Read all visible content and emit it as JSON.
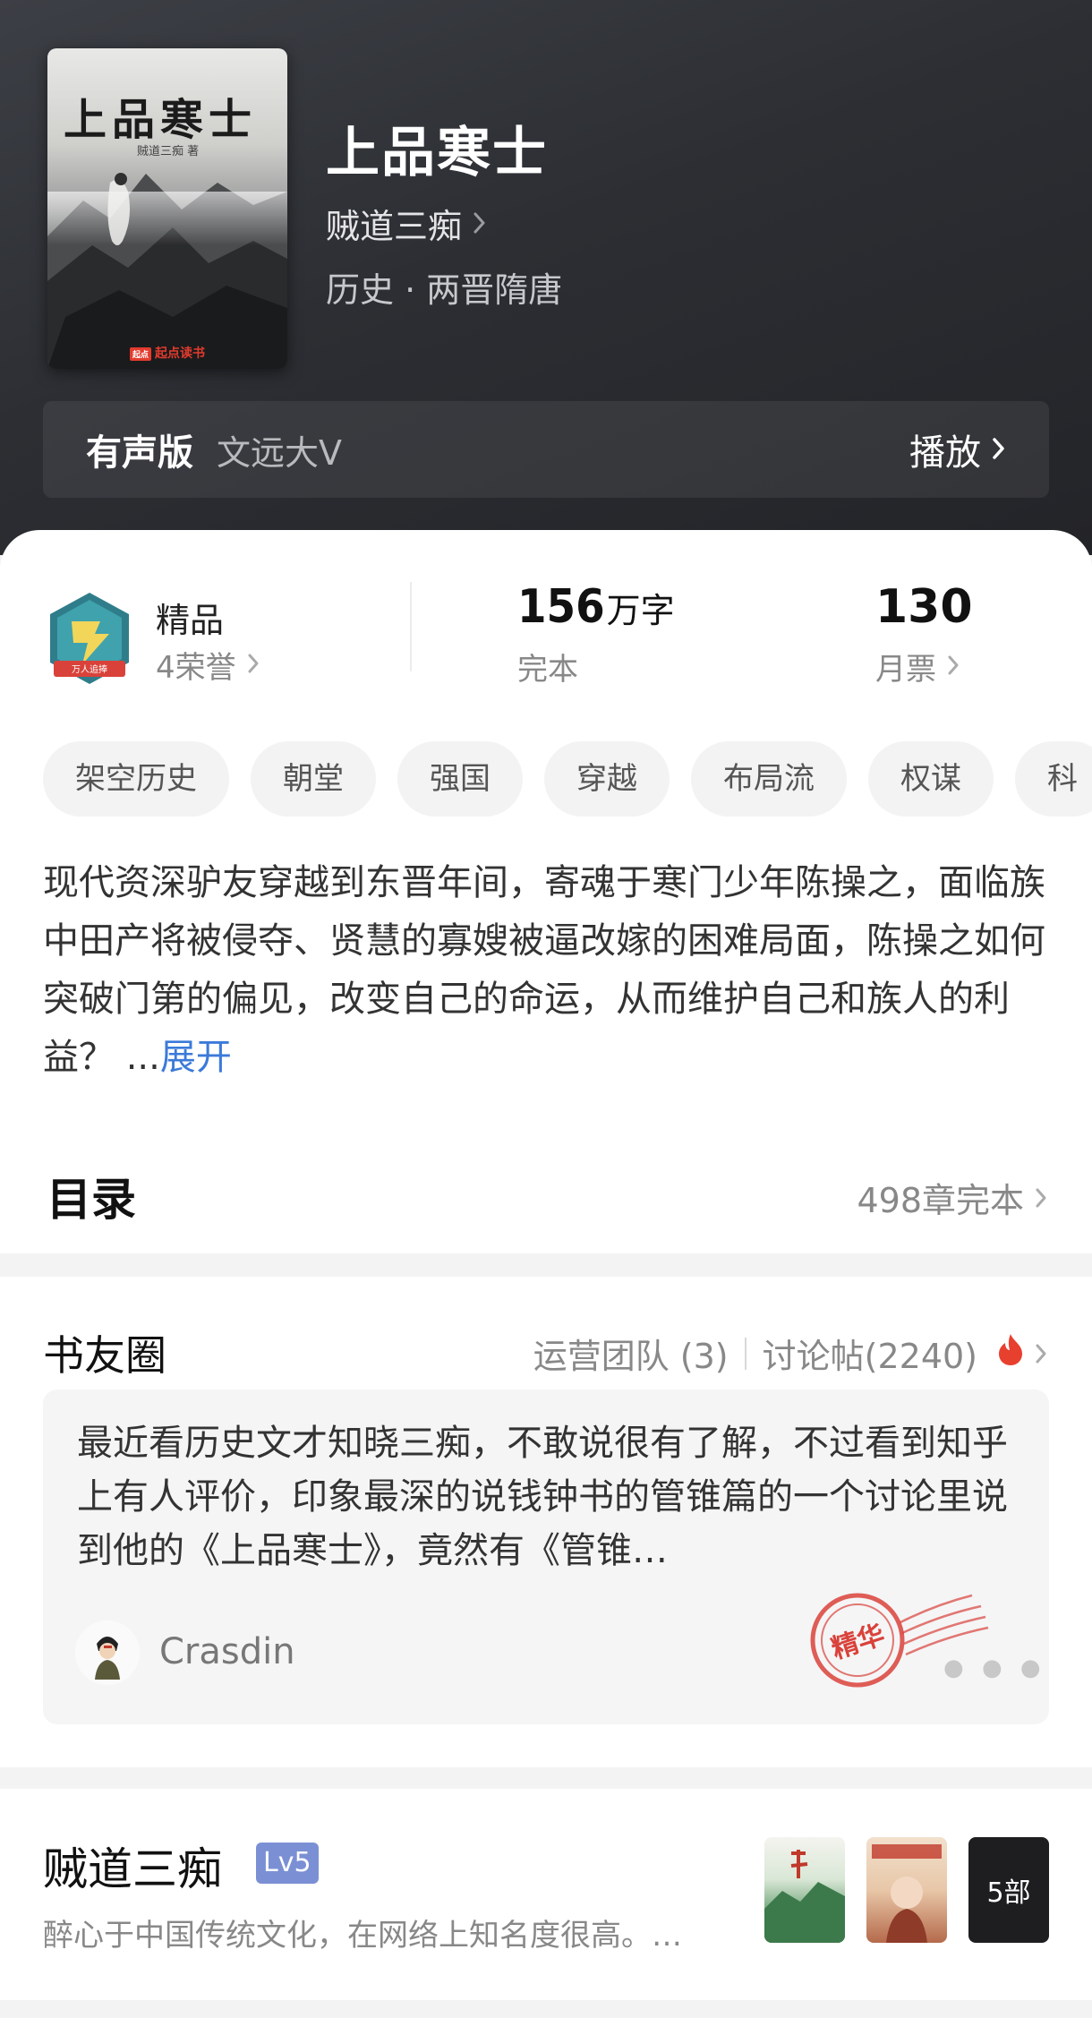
{
  "book": {
    "title": "上品寒士",
    "author": "贼道三痴",
    "category": "历史 · 两晋隋唐",
    "cover": {
      "title": "上品寒士",
      "author_line": "贼道三痴 著",
      "publisher_badge": "起点",
      "publisher": "起点读书"
    }
  },
  "audio": {
    "label": "有声版",
    "narrator": "文远大V",
    "play_label": "播放"
  },
  "stats": {
    "honor_title": "精品",
    "honor_sub": "4荣誉",
    "badge_text": "万人追捧",
    "word_count": "156",
    "word_unit": "万字",
    "word_label": "完本",
    "monthly_tickets": "130",
    "tickets_label": "月票"
  },
  "tags": [
    "架空历史",
    "朝堂",
    "强国",
    "穿越",
    "布局流",
    "权谋",
    "科"
  ],
  "intro": {
    "text": "现代资深驴友穿越到东晋年间，寄魂于寒门少年陈操之，面临族中田产将被侵夺、贤慧的寡嫂被逼改嫁的困难局面，陈操之如何突破门第的偏见，改变自己的命运，从而维护自己和族人的利益？ ...",
    "more_label": "展开"
  },
  "toc": {
    "title": "目录",
    "meta": "498章完本"
  },
  "community": {
    "title": "书友圈",
    "team": "运营团队 (3)",
    "posts": "讨论帖(2240)",
    "post": {
      "text": "最近看历史文才知晓三痴，不敢说很有了解，不过看到知乎上有人评价，印象最深的说钱钟书的管锥篇的一个讨论里说到他的《上品寒士》，竟然有《管锥…",
      "user": "Crasdin",
      "stamp": "精华"
    }
  },
  "author_card": {
    "name": "贼道三痴",
    "level": "Lv5",
    "bio": "醉心于中国传统文化，在网络上知名度很高。…",
    "works_count": "5部"
  },
  "colors": {
    "accent_link": "#3b7ad9",
    "fire": "#e8402f",
    "level_badge": "#7b90d4"
  }
}
